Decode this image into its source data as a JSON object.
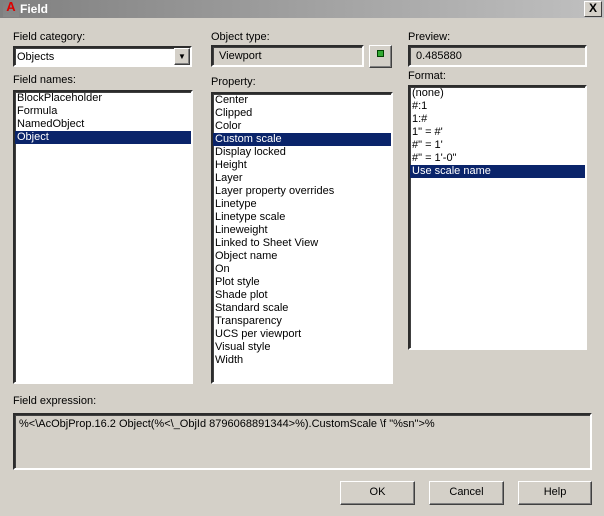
{
  "window": {
    "title": "Field",
    "close_label": "X"
  },
  "field_category": {
    "label": "Field category:",
    "value": "Objects"
  },
  "field_names": {
    "label": "Field names:",
    "items": [
      "BlockPlaceholder",
      "Formula",
      "NamedObject",
      "Object"
    ],
    "selected": "Object"
  },
  "object_type": {
    "label": "Object type:",
    "value": "Viewport"
  },
  "property": {
    "label": "Property:",
    "items": [
      "Center",
      "Clipped",
      "Color",
      "Custom scale",
      "Display locked",
      "Height",
      "Layer",
      "Layer property overrides",
      "Linetype",
      "Linetype scale",
      "Lineweight",
      "Linked to Sheet View",
      "Object name",
      "On",
      "Plot style",
      "Shade plot",
      "Standard scale",
      "Transparency",
      "UCS per viewport",
      "Visual style",
      "Width"
    ],
    "selected": "Custom scale"
  },
  "preview": {
    "label": "Preview:",
    "value": "0.485880"
  },
  "format": {
    "label": "Format:",
    "items": [
      "(none)",
      "#:1",
      "1:#",
      "1\" = #'",
      "#\" = 1'",
      "#\" = 1'-0\"",
      "Use scale name"
    ],
    "selected": "Use scale name"
  },
  "field_expression": {
    "label": "Field expression:",
    "value": "%<\\AcObjProp.16.2 Object(%<\\_ObjId 8796068891344>%).CustomScale \\f \"%sn\">%"
  },
  "buttons": {
    "ok": "OK",
    "cancel": "Cancel",
    "help": "Help"
  },
  "colors": {
    "selection": "#0a246a",
    "dialog": "#d4d0c8"
  }
}
